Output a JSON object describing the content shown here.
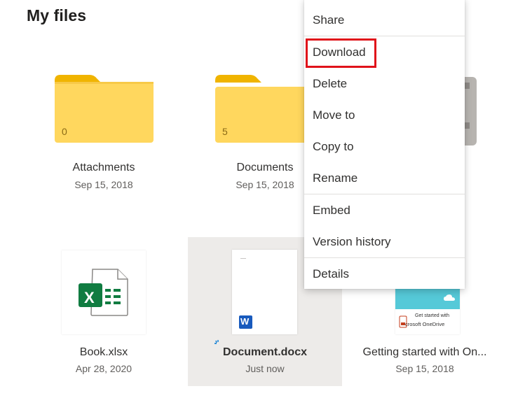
{
  "page": {
    "title": "My files"
  },
  "items": [
    {
      "name": "Attachments",
      "date": "Sep 15, 2018",
      "count": "0",
      "kind": "folder"
    },
    {
      "name": "Documents",
      "date": "Sep 15, 2018",
      "count": "5",
      "kind": "folder"
    },
    {
      "name": "Book.xlsx",
      "date": "Apr 28, 2020",
      "kind": "excel"
    },
    {
      "name": "Document.docx",
      "date": "Just now",
      "kind": "word",
      "selected": true
    },
    {
      "name": "Getting started with On...",
      "date": "Sep 15, 2018",
      "kind": "pdf",
      "thumb_text_1": "Get started with",
      "thumb_text_2": "crosoft OneDrive"
    }
  ],
  "context_menu": {
    "items": [
      {
        "label": "Share"
      },
      {
        "label": "Download",
        "highlighted": true
      },
      {
        "label": "Delete"
      },
      {
        "label": "Move to"
      },
      {
        "label": "Copy to"
      },
      {
        "label": "Rename"
      },
      {
        "label": "Embed"
      },
      {
        "label": "Version history"
      },
      {
        "label": "Details"
      }
    ]
  },
  "icons": {
    "excel_letter": "X",
    "word_letter": "W"
  },
  "colors": {
    "folder_front": "#ffd75e",
    "folder_back": "#f0b400",
    "excel_green": "#107c41",
    "word_blue": "#185abd",
    "highlight_red": "#e0121a",
    "selected_bg": "#edebe9",
    "loading_blue": "#0078d4"
  }
}
